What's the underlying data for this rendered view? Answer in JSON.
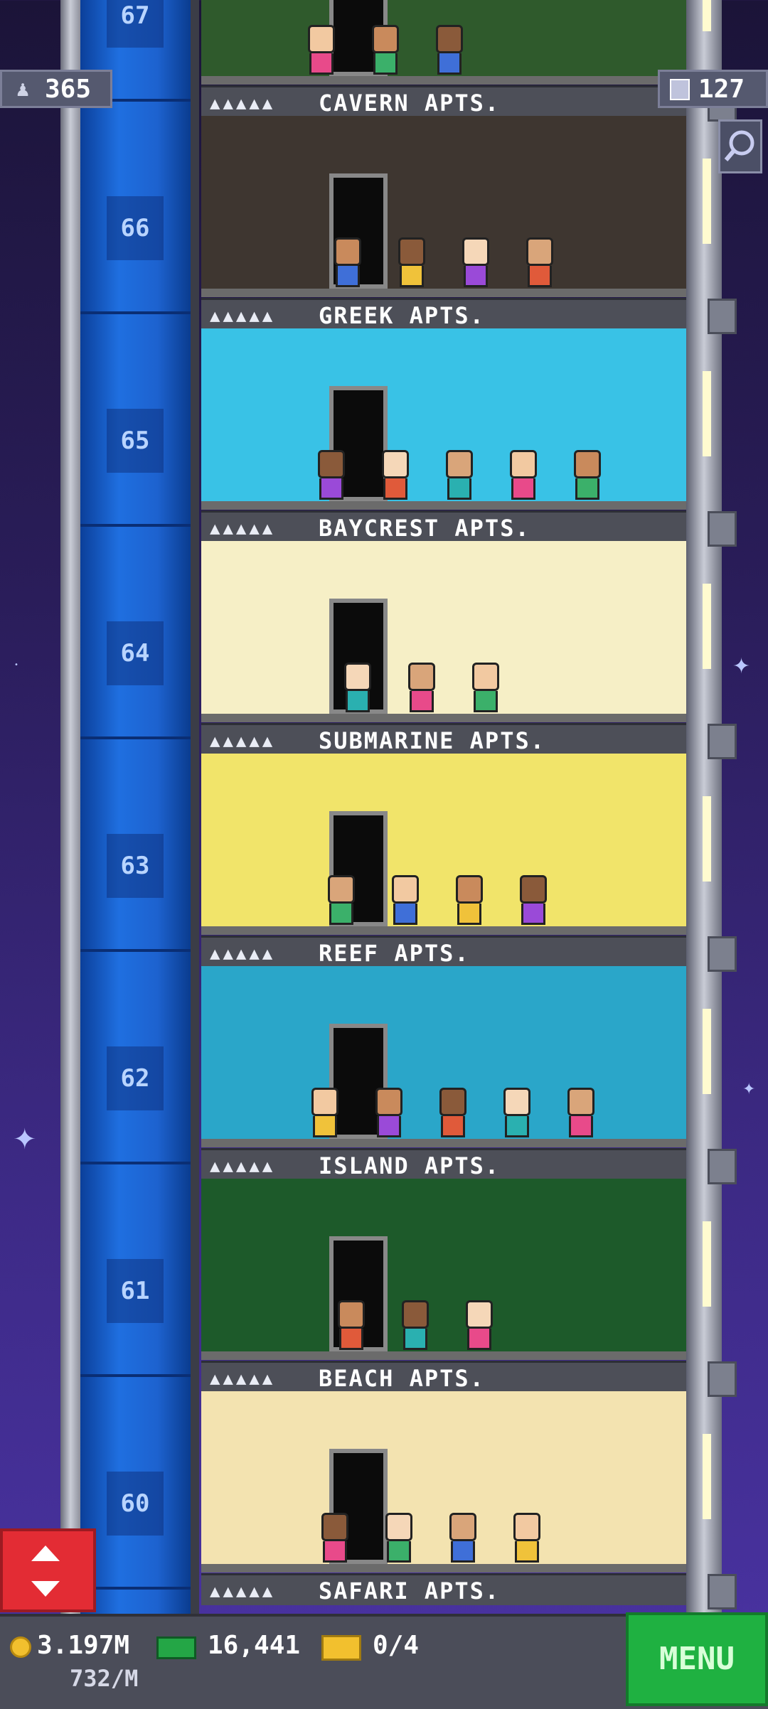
{
  "game": "Tiny Tower",
  "top_stats": {
    "population": "365",
    "floors": "127"
  },
  "floors": [
    {
      "number": "67",
      "label": "CAVERN APTS.",
      "theme": "forest",
      "bg": "#2f5a2c"
    },
    {
      "number": "66",
      "label": "GREEK APTS.",
      "theme": "cavern",
      "bg": "#3e3630"
    },
    {
      "number": "65",
      "label": "BAYCREST APTS.",
      "theme": "greek",
      "bg": "#39c2e6"
    },
    {
      "number": "64",
      "label": "SUBMARINE APTS.",
      "theme": "baycrest",
      "bg": "#f6efc6"
    },
    {
      "number": "63",
      "label": "REEF APTS.",
      "theme": "submarine",
      "bg": "#f1e46a"
    },
    {
      "number": "62",
      "label": "ISLAND APTS.",
      "theme": "reef",
      "bg": "#2aa6c9"
    },
    {
      "number": "61",
      "label": "BEACH APTS.",
      "theme": "island",
      "bg": "#1d5a2a"
    },
    {
      "number": "60",
      "label": "SAFARI APTS.",
      "theme": "beach",
      "bg": "#f3e3b0"
    }
  ],
  "bottom_bar": {
    "coins": "3.197M",
    "coins_rate": "732/M",
    "bux": "16,441",
    "tickets": "0/4",
    "menu_label": "MENU"
  },
  "icons": {
    "population": "person-icon",
    "floors": "building-icon",
    "search": "magnifier-icon",
    "elevator": "up-down-arrows-icon",
    "coins": "coin-icon",
    "bux": "banknote-icon",
    "tickets": "ticket-icon"
  },
  "colors": {
    "shaft": "#1f6fe0",
    "elevator_button": "#e32c34",
    "menu_button": "#1fb141"
  }
}
